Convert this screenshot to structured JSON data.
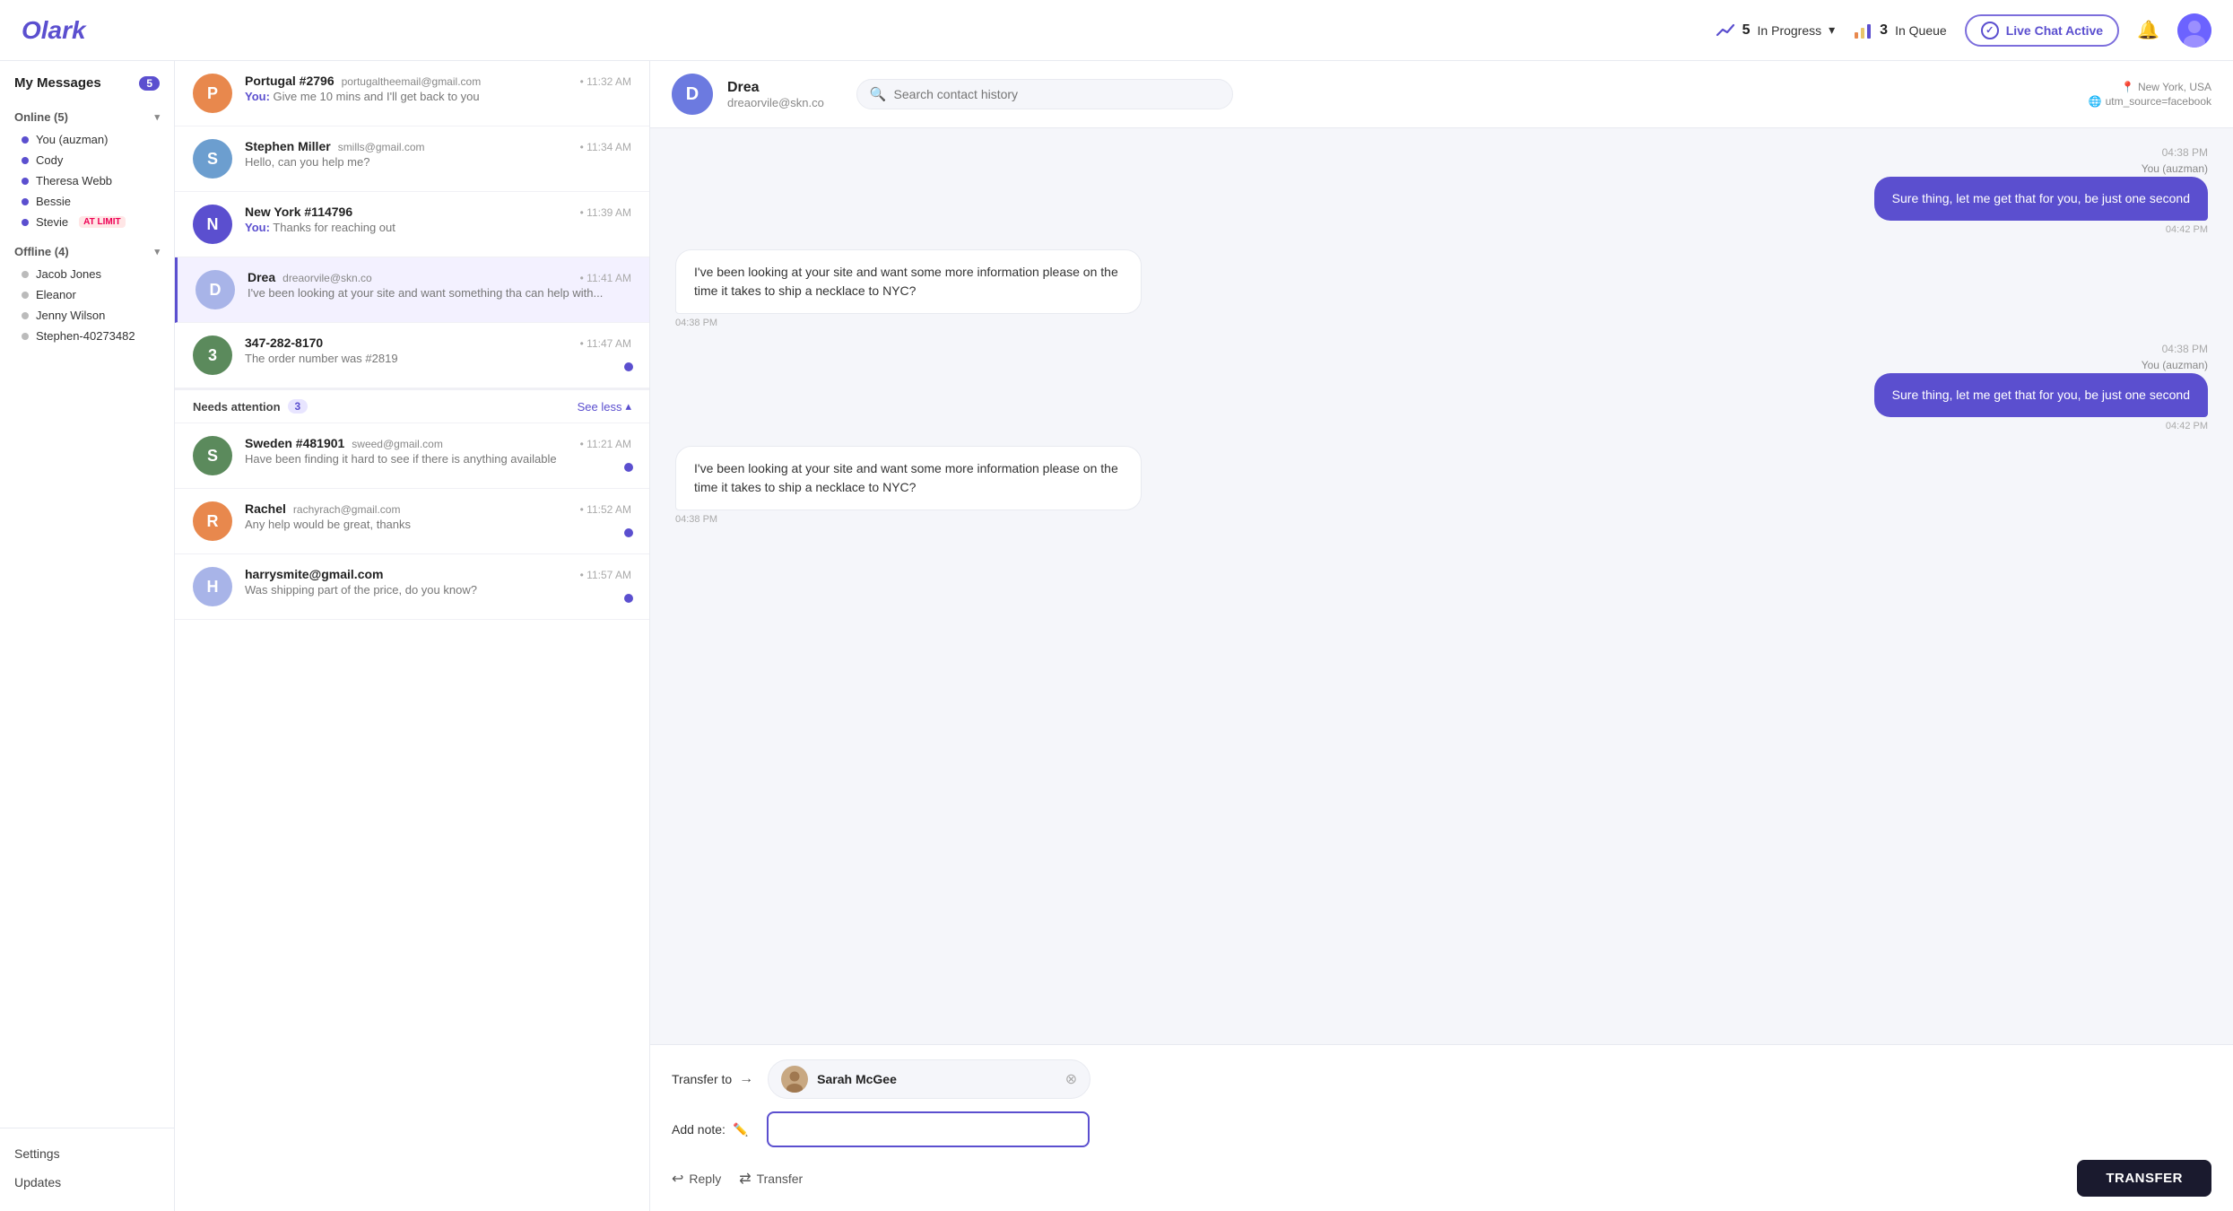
{
  "app": {
    "logo": "Olark"
  },
  "header": {
    "in_progress_count": "5",
    "in_progress_label": "In Progress",
    "in_queue_count": "3",
    "in_queue_label": "In Queue",
    "live_chat_label": "Live Chat Active"
  },
  "sidebar": {
    "title": "My Messages",
    "count": "5",
    "online_section": "Online (5)",
    "users_online": [
      {
        "name": "You (auzman)",
        "status": "online"
      },
      {
        "name": "Cody",
        "status": "online"
      },
      {
        "name": "Theresa Webb",
        "status": "online"
      },
      {
        "name": "Bessie",
        "status": "online"
      },
      {
        "name": "Stevie",
        "status": "online",
        "badge": "AT LIMIT"
      }
    ],
    "offline_section": "Offline (4)",
    "users_offline": [
      {
        "name": "Jacob Jones"
      },
      {
        "name": "Eleanor"
      },
      {
        "name": "Jenny Wilson"
      },
      {
        "name": "Stephen-40273482"
      }
    ],
    "settings_label": "Settings",
    "updates_label": "Updates"
  },
  "conversations": [
    {
      "id": "portugal",
      "avatar_letter": "P",
      "avatar_color": "#e8884d",
      "name": "Portugal #2796",
      "email": "portugaltheemail@gmail.com",
      "time": "11:32 AM",
      "preview_you": "You:",
      "preview": "Give me 10 mins and I'll get back to you",
      "unread": false,
      "active": false
    },
    {
      "id": "stephen",
      "avatar_letter": "S",
      "avatar_color": "#6c9ecf",
      "name": "Stephen Miller",
      "email": "smills@gmail.com",
      "time": "11:34 AM",
      "preview_you": "",
      "preview": "Hello, can you help me?",
      "unread": false,
      "active": false
    },
    {
      "id": "newyork",
      "avatar_letter": "N",
      "avatar_color": "#5b4fcf",
      "name": "New York #114796",
      "email": "",
      "time": "11:39 AM",
      "preview_you": "You:",
      "preview": "Thanks for reaching out",
      "unread": false,
      "active": false
    },
    {
      "id": "drea",
      "avatar_letter": "D",
      "avatar_color": "#a8b4e8",
      "name": "Drea",
      "email": "dreaorvile@skn.co",
      "time": "11:41 AM",
      "preview_you": "",
      "preview": "I've been looking at your site and want something tha can help with...",
      "unread": false,
      "active": true
    },
    {
      "id": "phone",
      "avatar_letter": "3",
      "avatar_color": "#5b8a5c",
      "name": "347-282-8170",
      "email": "",
      "time": "11:47 AM",
      "preview_you": "",
      "preview": "The order number was #2819",
      "unread": true,
      "active": false
    }
  ],
  "needs_attention": {
    "label": "Needs attention",
    "count": "3",
    "see_less": "See less",
    "items": [
      {
        "avatar_letter": "S",
        "avatar_color": "#5b8a5c",
        "name": "Sweden #481901",
        "email": "sweed@gmail.com",
        "time": "11:21 AM",
        "preview": "Have been finding it hard to see if there is anything available",
        "unread": true
      },
      {
        "avatar_letter": "R",
        "avatar_color": "#e8884d",
        "name": "Rachel",
        "email": "rachyrach@gmail.com",
        "time": "11:52 AM",
        "preview": "Any help would be great, thanks",
        "unread": true
      },
      {
        "avatar_letter": "H",
        "avatar_color": "#a8b4e8",
        "name": "harrysmite@gmail.com",
        "email": "",
        "time": "11:57 AM",
        "preview": "Was shipping part of the price, do you know?",
        "unread": true
      }
    ]
  },
  "chat": {
    "contact_name": "Drea",
    "contact_email": "dreaorvile@skn.co",
    "contact_avatar": "D",
    "contact_location": "New York, USA",
    "contact_source": "utm_source=facebook",
    "search_placeholder": "Search contact history",
    "messages": [
      {
        "id": "msg1",
        "type": "sent",
        "sender": "You (auzman)",
        "text": "Sure thing, let me get that for you, be just one second",
        "time": "04:42 PM",
        "time_label": "04:38 PM"
      },
      {
        "id": "msg2",
        "type": "received",
        "text": "I've been looking at your site and want some more information please on the time it takes to ship a necklace to NYC?",
        "time": "04:38 PM"
      },
      {
        "id": "msg3",
        "type": "sent",
        "sender": "You (auzman)",
        "text": "Sure thing, let me get that for you, be just one second",
        "time": "04:42 PM",
        "time_label": "04:38 PM"
      },
      {
        "id": "msg4",
        "type": "received",
        "text": "I've been looking at your site and want some more information please on the time it takes to ship a necklace to NYC?",
        "time": "04:38 PM"
      }
    ],
    "transfer": {
      "label": "Transfer to",
      "assignee": "Sarah McGee",
      "note_label": "Add note:",
      "note_placeholder": "",
      "reply_label": "Reply",
      "transfer_action_label": "Transfer",
      "transfer_btn": "TRANSFER"
    }
  }
}
